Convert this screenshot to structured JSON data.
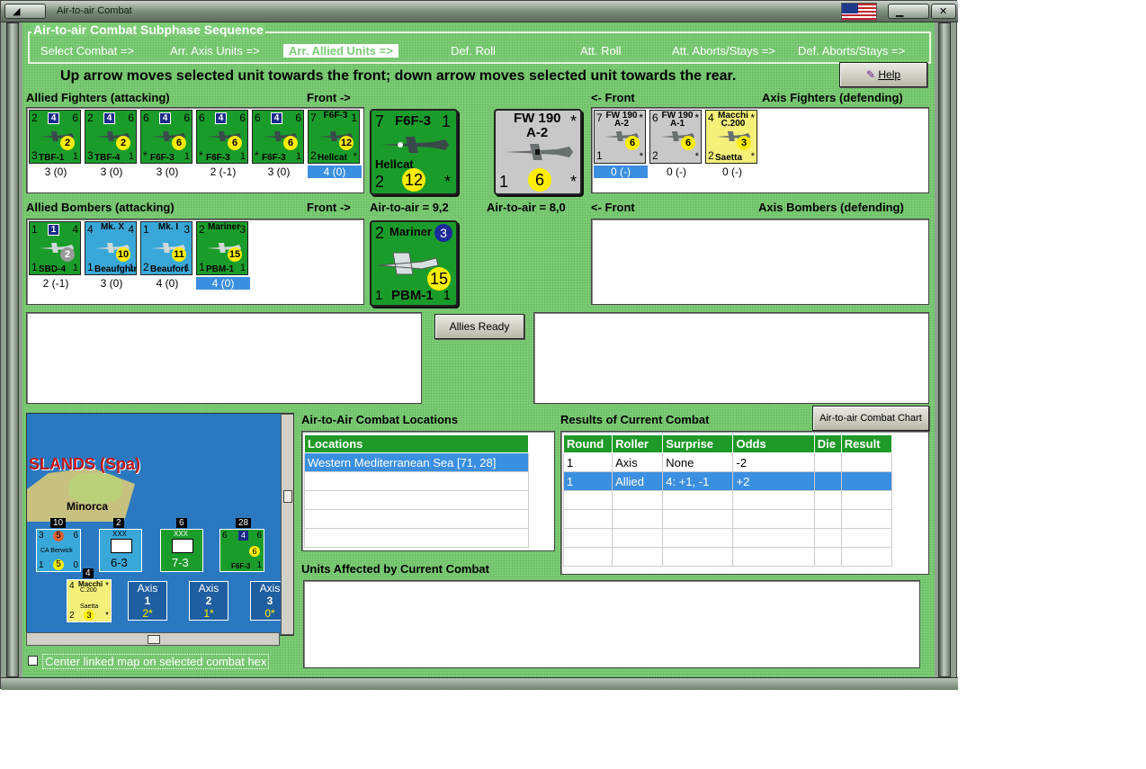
{
  "window": {
    "title": "Air-to-air Combat"
  },
  "subphase": {
    "title": "Air-to-air Combat Subphase Sequence",
    "steps": [
      "Select Combat =>",
      "Arr. Axis Units =>",
      "Arr. Allied Units =>",
      "Def. Roll",
      "Att. Roll",
      "Att. Aborts/Stays =>",
      "Def. Aborts/Stays =>"
    ],
    "active_index": 2
  },
  "instruction": "Up arrow moves selected unit towards the front; down arrow moves selected unit towards the rear.",
  "help_label": "Help",
  "allied_fighters": {
    "label": "Allied Fighters (attacking)",
    "front": "Front ->",
    "units": [
      {
        "tl": "2",
        "tr": "6",
        "badge": "4",
        "circ": "2",
        "bl": "3",
        "name": "TBF-1",
        "br": "1",
        "value": "3 (0)"
      },
      {
        "tl": "2",
        "tr": "6",
        "badge": "4",
        "circ": "2",
        "bl": "3",
        "name": "TBF-4",
        "br": "1",
        "value": "3 (0)"
      },
      {
        "tl": "6",
        "tr": "6",
        "badge": "4",
        "circ": "6",
        "bl": "*",
        "name": "F6F-3",
        "br": "1",
        "value": "3 (0)"
      },
      {
        "tl": "6",
        "tr": "6",
        "badge": "4",
        "circ": "6",
        "bl": "*",
        "name": "F6F-3",
        "br": "1",
        "value": "2 (-1)"
      },
      {
        "tl": "6",
        "tr": "6",
        "badge": "4",
        "circ": "6",
        "bl": "*",
        "name": "F6F-3",
        "br": "1",
        "value": "3 (0)"
      },
      {
        "tl": "7",
        "tr": "1",
        "topname": "F6F-3",
        "circ": "12",
        "bl": "2",
        "name": "Hellcat",
        "br": "*",
        "value": "4 (0)"
      }
    ],
    "selected_index": 5
  },
  "allied_fighter_big": {
    "tl": "7",
    "name": "F6F-3",
    "tr": "1",
    "sub": "Hellcat",
    "bl": "2",
    "circ": "12",
    "br": "*"
  },
  "axis_fighter_big": {
    "tl": "1",
    "name": "FW 190",
    "sub": "A-2",
    "tr": "*",
    "circ": "6",
    "br": "*"
  },
  "axis_fighters": {
    "label": "Axis Fighters (defending)",
    "front": "<- Front",
    "units": [
      {
        "tl": "7",
        "topname": "FW 190",
        "sub": "A-2",
        "tr": "*",
        "bl": "1",
        "circ": "6",
        "br": "*",
        "value": "0 (-)"
      },
      {
        "tl": "6",
        "topname": "FW 190",
        "sub": "A-1",
        "tr": "*",
        "bl": "2",
        "circ": "6",
        "br": "*",
        "value": "0 (-)"
      },
      {
        "tl": "4",
        "topname": "Macchi",
        "sub": "C.200",
        "tr": "*",
        "bl": "2",
        "circ": "3",
        "br": "*",
        "name": "Saetta",
        "value": "0 (-)"
      }
    ],
    "selected_index": 0
  },
  "allied_bombers": {
    "label": "Allied Bombers (attacking)",
    "front": "Front ->",
    "units": [
      {
        "tl": "1",
        "tr": "4",
        "badge": "1",
        "circ": "2",
        "bl": "1",
        "name": "SBD-4",
        "br": "1",
        "value": "2 (-1)"
      },
      {
        "tl": "4",
        "tr": "4",
        "topname": "Mk. X",
        "circ": "10",
        "bl": "1",
        "name": "Beaufghtr",
        "br": "1",
        "value": "3 (0)"
      },
      {
        "tl": "1",
        "tr": "3",
        "topname": "Mk. I",
        "circ": "11",
        "bl": "2",
        "name": "Beaufort",
        "br": "1",
        "value": "4 (0)"
      },
      {
        "tl": "2",
        "tr": "3",
        "topname": "Mariner",
        "circ": "15",
        "bl": "1",
        "name": "PBM-1",
        "br": "1",
        "value": "4 (0)"
      }
    ],
    "selected_index": 3
  },
  "allied_bomber_big": {
    "tl": "2",
    "name": "Mariner",
    "badge": "3",
    "circ": "15",
    "bl": "1",
    "sub": "PBM-1",
    "br": "1"
  },
  "air_to_air_allied": "Air-to-air = 9,2",
  "air_to_air_axis": "Air-to-air = 8,0",
  "axis_bombers": {
    "label": "Axis Bombers (defending)",
    "front": "<- Front"
  },
  "allies_ready_label": "Allies Ready",
  "chart_button_label": "Air-to-air Combat Chart",
  "locations": {
    "section_label": "Air-to-Air Combat Locations",
    "header": "Locations",
    "rows": [
      "Western Mediterranean Sea [71, 28]"
    ]
  },
  "results": {
    "section_label": "Results of Current Combat",
    "headers": [
      "Round",
      "Roller",
      "Surprise",
      "Odds",
      "Die",
      "Result"
    ],
    "rows": [
      [
        "1",
        "Axis",
        "None",
        "-2",
        "",
        ""
      ],
      [
        "1",
        "Allied",
        "4: +1, -1",
        "+2",
        "",
        ""
      ]
    ],
    "selected_index": 1
  },
  "units_affected_label": "Units Affected by Current Combat",
  "map": {
    "region_label": "SLANDS (Spa)",
    "island_label": "Minorca",
    "stack_counts": [
      "10",
      "2",
      "6",
      "28",
      "4"
    ],
    "naval_counter": {
      "tl": "3",
      "circ": "5",
      "tr": "6",
      "name": "CA Berwick",
      "bl": "1",
      "circ2": "5",
      "br": "0"
    },
    "corps1": {
      "top": "XXX",
      "value": "6-3"
    },
    "corps2": {
      "top": "XXX",
      "value": "7-3"
    },
    "f6f": {
      "tl": "6",
      "badge": "4",
      "tr": "6",
      "circ": "6",
      "name": "F6F-3",
      "br": "1"
    },
    "macchi": {
      "tl": "4",
      "name": "Macchi",
      "sub": "C.200",
      "tr": "*",
      "bl": "2",
      "circ": "3",
      "br": "*",
      "bot": "Saetta"
    },
    "axis_boxes": [
      {
        "label": "Axis",
        "num": "1",
        "val": "2*"
      },
      {
        "label": "Axis",
        "num": "2",
        "val": "1*"
      },
      {
        "label": "Axis",
        "num": "3",
        "val": "0*"
      }
    ]
  },
  "center_map_label": "Center linked map on selected combat hex",
  "colors": {
    "panel_green": "#7ccc75",
    "counter_green": "#1a9c2a",
    "selection_blue": "#3b8fe0",
    "header_green": "#1f9a28"
  }
}
